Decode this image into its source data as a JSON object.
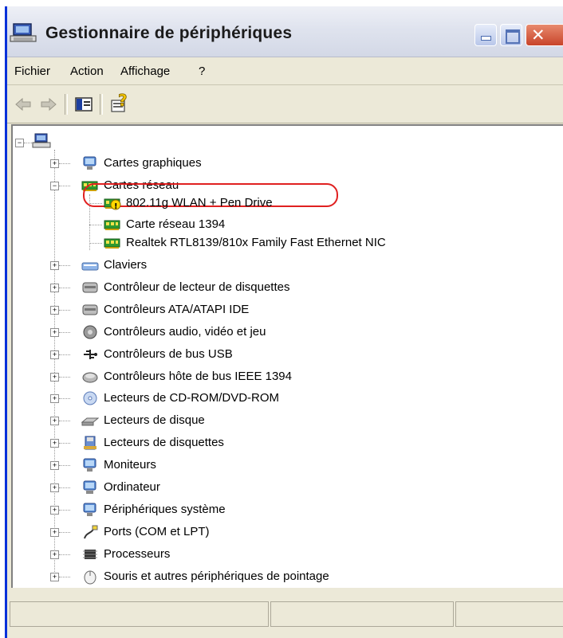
{
  "window": {
    "title": "Gestionnaire de périphériques"
  },
  "menu": {
    "items": [
      {
        "id": "fichier",
        "label": "Fichier"
      },
      {
        "id": "action",
        "label": "Action"
      },
      {
        "id": "affichage",
        "label": "Affichage"
      },
      {
        "id": "aide",
        "label": "?"
      }
    ]
  },
  "toolbar": {
    "buttons": [
      {
        "id": "back",
        "icon": "back-arrow-icon"
      },
      {
        "id": "forward",
        "icon": "forward-arrow-icon"
      },
      {
        "id": "show-hide",
        "icon": "console-tree-icon"
      },
      {
        "id": "help",
        "icon": "help-icon"
      }
    ]
  },
  "tree": {
    "root": {
      "icon": "computer-icon",
      "label": ""
    },
    "cartes_graphiques": "Cartes graphiques",
    "cartes_reseau": "Cartes réseau",
    "network_children": [
      {
        "label": "802.11g WLAN + Pen Drive",
        "icon": "network-card-warning-icon",
        "warning": true
      },
      {
        "label": "Carte réseau 1394",
        "icon": "network-card-icon",
        "warning": false
      },
      {
        "label": "Realtek RTL8139/810x Family Fast Ethernet NIC",
        "icon": "network-card-icon",
        "warning": false
      }
    ],
    "categories": [
      {
        "label": "Claviers",
        "icon": "keyboard-icon"
      },
      {
        "label": "Contrôleur de lecteur de disquettes",
        "icon": "controller-icon"
      },
      {
        "label": "Contrôleurs ATA/ATAPI IDE",
        "icon": "controller-icon"
      },
      {
        "label": "Contrôleurs audio, vidéo et jeu",
        "icon": "audio-icon"
      },
      {
        "label": "Contrôleurs de bus USB",
        "icon": "usb-icon"
      },
      {
        "label": "Contrôleurs hôte de bus IEEE 1394",
        "icon": "ieee1394-icon"
      },
      {
        "label": "Lecteurs de CD-ROM/DVD-ROM",
        "icon": "cdrom-icon"
      },
      {
        "label": "Lecteurs de disque",
        "icon": "disk-drive-icon"
      },
      {
        "label": "Lecteurs de disquettes",
        "icon": "floppy-icon"
      },
      {
        "label": "Moniteurs",
        "icon": "monitor-icon"
      },
      {
        "label": "Ordinateur",
        "icon": "computer-small-icon"
      },
      {
        "label": "Périphériques système",
        "icon": "system-device-icon"
      },
      {
        "label": "Ports (COM et LPT)",
        "icon": "port-icon"
      },
      {
        "label": "Processeurs",
        "icon": "processor-icon"
      },
      {
        "label": "Souris et autres périphériques de pointage",
        "icon": "mouse-icon"
      }
    ]
  },
  "colors": {
    "highlight": "#e02020",
    "window_face": "#ece9d8",
    "title_border": "#0831d9"
  }
}
